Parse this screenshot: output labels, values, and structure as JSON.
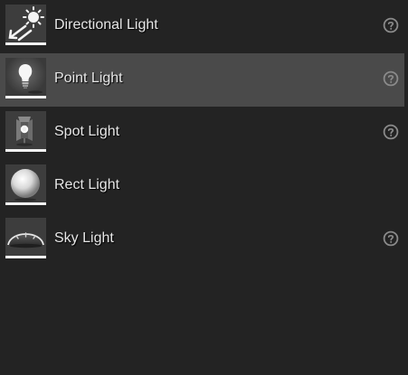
{
  "items": [
    {
      "label": "Directional Light",
      "icon": "directional-light-icon",
      "has_help": true,
      "selected": false
    },
    {
      "label": "Point Light",
      "icon": "point-light-icon",
      "has_help": true,
      "selected": true
    },
    {
      "label": "Spot Light",
      "icon": "spot-light-icon",
      "has_help": true,
      "selected": false
    },
    {
      "label": "Rect Light",
      "icon": "rect-light-icon",
      "has_help": false,
      "selected": false
    },
    {
      "label": "Sky Light",
      "icon": "sky-light-icon",
      "has_help": true,
      "selected": false
    }
  ],
  "help_icon": "question-circle-icon",
  "colors": {
    "background": "#232323",
    "selected_row": "#4a4a4a",
    "text": "#e6e6e6",
    "thumb_bar": "#f2f2f2"
  }
}
